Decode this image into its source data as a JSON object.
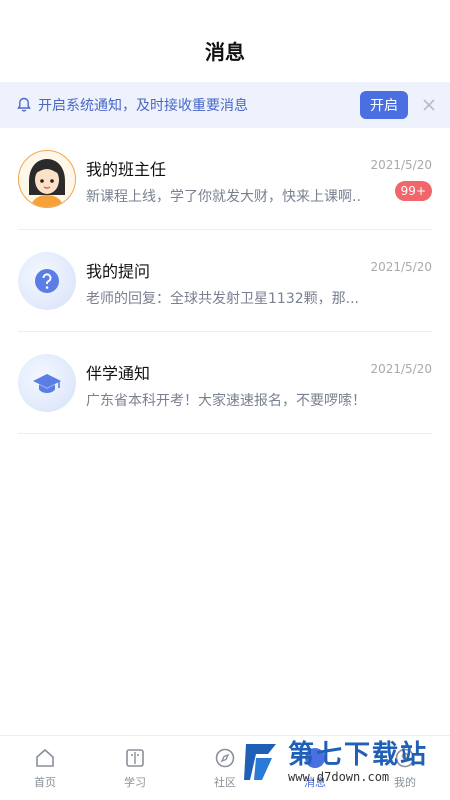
{
  "header": {
    "title": "消息"
  },
  "notice": {
    "text": "开启系统通知，及时接收重要消息",
    "button_label": "开启",
    "bell_icon": "bell-icon",
    "close_icon": "close-icon"
  },
  "messages": [
    {
      "title": "我的班主任",
      "preview": "新课程上线，学了你就发大财，快来上课啊..",
      "date": "2021/5/20",
      "badge": "99+",
      "avatar": "teacher-avatar"
    },
    {
      "title": "我的提问",
      "preview": "老师的回复：全球共发射卫星1132颗，那...",
      "date": "2021/5/20",
      "badge": "",
      "avatar": "question-icon"
    },
    {
      "title": "伴学通知",
      "preview": "广东省本科开考！大家速速报名，不要啰嗦！",
      "date": "2021/5/20",
      "badge": "",
      "avatar": "graduation-cap-icon"
    }
  ],
  "tabbar": {
    "items": [
      {
        "label": "首页",
        "icon": "home-icon"
      },
      {
        "label": "学习",
        "icon": "book-icon"
      },
      {
        "label": "社区",
        "icon": "compass-icon"
      },
      {
        "label": "消息",
        "icon": "message-icon"
      },
      {
        "label": "我的",
        "icon": "user-icon"
      }
    ],
    "active_index": 3
  },
  "watermark": {
    "brand": "第七下载站",
    "url": "www.d7down.com"
  },
  "colors": {
    "accent": "#4a6fe0",
    "badge": "#f0666b",
    "notice_bg": "#eef2fc"
  }
}
